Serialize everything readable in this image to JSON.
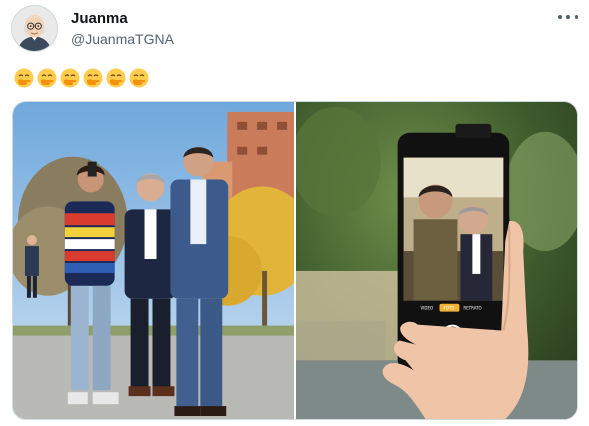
{
  "author": {
    "display_name": "Juanma",
    "handle": "@JuanmaTGNA",
    "avatar_icon": "avatar-illustration"
  },
  "tweet": {
    "text_emojis": [
      "🤭",
      "🤭",
      "🤭",
      "🤭",
      "🤭",
      "🤭"
    ],
    "emoji_icon": "face-with-hand-over-mouth-icon"
  },
  "menu": {
    "icon": "more-horizontal-icon"
  },
  "media": {
    "count": 2,
    "photos": [
      {
        "description_icon": "photo-group-selfie"
      },
      {
        "description_icon": "photo-phone-screen-selfie"
      }
    ],
    "camera_modes": [
      "VIDEO",
      "FOTO",
      "RETRATO"
    ]
  },
  "colors": {
    "text_primary": "#0f1419",
    "text_secondary": "#536471",
    "border": "#cfd9de",
    "emoji_yellow": "#ffcc4d"
  }
}
